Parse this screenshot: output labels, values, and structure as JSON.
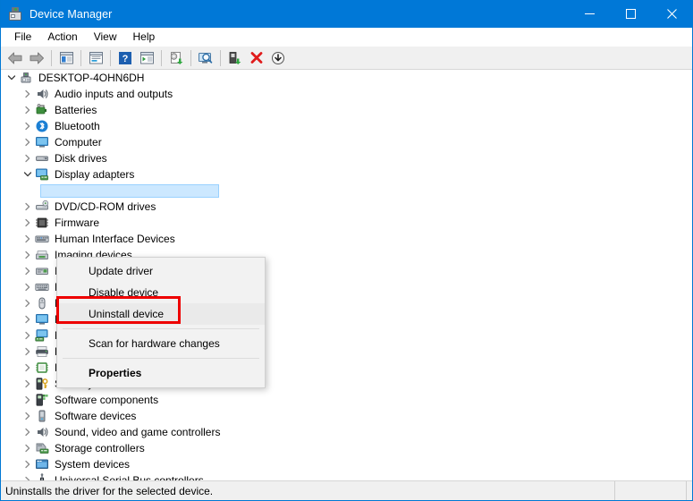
{
  "window": {
    "title": "Device Manager",
    "icon": "device-manager-icon",
    "accent_color": "#0078d7",
    "controls": [
      {
        "name": "minimize",
        "glyph": "minimize-icon"
      },
      {
        "name": "maximize",
        "glyph": "maximize-icon"
      },
      {
        "name": "close",
        "glyph": "close-icon"
      }
    ]
  },
  "menubar": {
    "items": [
      {
        "label": "File"
      },
      {
        "label": "Action"
      },
      {
        "label": "View"
      },
      {
        "label": "Help"
      }
    ]
  },
  "toolbar": {
    "buttons": [
      {
        "name": "back-icon",
        "tip": "Back"
      },
      {
        "name": "forward-icon",
        "tip": "Forward"
      },
      {
        "name": "show-hide-console-tree-icon",
        "tip": "Show/Hide Console Tree"
      },
      {
        "name": "properties-icon",
        "tip": "Properties"
      },
      {
        "name": "help-icon",
        "tip": "Help"
      },
      {
        "name": "show-hide-action-pane-icon",
        "tip": "Show/Hide Action Pane"
      },
      {
        "name": "update-driver-icon",
        "tip": "Update driver"
      },
      {
        "name": "scan-for-hardware-changes-icon",
        "tip": "Scan for hardware changes"
      },
      {
        "name": "enable-device-icon",
        "tip": "Enable device"
      },
      {
        "name": "uninstall-device-icon",
        "tip": "Uninstall device"
      },
      {
        "name": "disable-device-icon",
        "tip": "Disable device"
      }
    ]
  },
  "tree": {
    "root": {
      "label": "DESKTOP-4OHN6DH",
      "icon": "computer-root-icon",
      "expanded": true
    },
    "nodes": [
      {
        "label": "Audio inputs and outputs",
        "icon": "speaker-icon",
        "expanded": false
      },
      {
        "label": "Batteries",
        "icon": "battery-icon",
        "expanded": false
      },
      {
        "label": "Bluetooth",
        "icon": "bluetooth-icon",
        "expanded": false
      },
      {
        "label": "Computer",
        "icon": "monitor-icon",
        "expanded": false
      },
      {
        "label": "Disk drives",
        "icon": "disk-drive-icon",
        "expanded": false
      },
      {
        "label": "Display adapters",
        "icon": "display-adapter-icon",
        "expanded": true,
        "selected_child": true
      },
      {
        "label": "DVD/CD-ROM drives",
        "icon": "optical-drive-icon",
        "expanded": false
      },
      {
        "label": "Firmware",
        "icon": "firmware-chip-icon",
        "expanded": false
      },
      {
        "label": "Human Interface Devices",
        "icon": "hid-icon",
        "expanded": false
      },
      {
        "label": "Imaging devices",
        "icon": "imaging-device-icon",
        "expanded": false
      },
      {
        "label": "IDE ATA/ATAPI controllers",
        "icon": "ide-controller-icon",
        "expanded": false
      },
      {
        "label": "Keyboards",
        "icon": "keyboard-icon",
        "expanded": false
      },
      {
        "label": "Mice and other pointing devices",
        "icon": "mouse-icon",
        "expanded": false
      },
      {
        "label": "Monitors",
        "icon": "monitor-icon",
        "expanded": false
      },
      {
        "label": "Network adapters",
        "icon": "network-adapter-icon",
        "expanded": false
      },
      {
        "label": "Print queues",
        "icon": "printer-icon",
        "expanded": false
      },
      {
        "label": "Processors",
        "icon": "processor-icon",
        "expanded": false
      },
      {
        "label": "Security devices",
        "icon": "security-device-icon",
        "expanded": false
      },
      {
        "label": "Software components",
        "icon": "software-component-icon",
        "expanded": false
      },
      {
        "label": "Software devices",
        "icon": "software-device-icon",
        "expanded": false
      },
      {
        "label": "Sound, video and game controllers",
        "icon": "sound-controller-icon",
        "expanded": false
      },
      {
        "label": "Storage controllers",
        "icon": "storage-controller-icon",
        "expanded": false
      },
      {
        "label": "System devices",
        "icon": "system-device-icon",
        "expanded": false
      },
      {
        "label": "Universal Serial Bus controllers",
        "icon": "usb-controller-icon",
        "expanded": false
      }
    ]
  },
  "context_menu": {
    "items": [
      {
        "label": "Update driver",
        "bold": false,
        "highlighted": false
      },
      {
        "label": "Disable device",
        "bold": false,
        "highlighted": false
      },
      {
        "label": "Uninstall device",
        "bold": false,
        "highlighted": true
      },
      {
        "label": "Scan for hardware changes",
        "bold": false,
        "highlighted": false
      },
      {
        "label": "Properties",
        "bold": true,
        "highlighted": false
      }
    ]
  },
  "annotation": {
    "target_label": "Uninstall device",
    "color": "#ee0000"
  },
  "statusbar": {
    "message": "Uninstalls the driver for the selected device."
  }
}
